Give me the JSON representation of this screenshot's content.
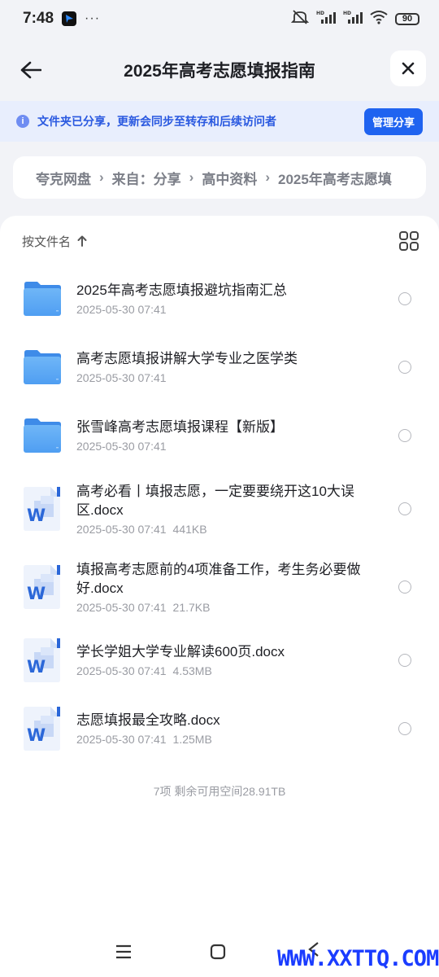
{
  "status_bar": {
    "time": "7:48",
    "more": "···",
    "battery": "90",
    "icons": [
      "app-icon",
      "mute-icon",
      "signal-icon",
      "signal-icon",
      "wifi-icon",
      "battery-icon"
    ]
  },
  "header": {
    "title": "2025年高考志愿填报指南"
  },
  "banner": {
    "text": "文件夹已分享，更新会同步至转存和后续访问者",
    "button": "管理分享"
  },
  "breadcrumb": {
    "items": [
      "夸克网盘",
      "来自：分享",
      "高中资料",
      "2025年高考志愿填"
    ]
  },
  "sort": {
    "label": "按文件名"
  },
  "files": [
    {
      "type": "folder",
      "name": "2025年高考志愿填报避坑指南汇总",
      "date": "2025-05-30 07:41",
      "size": ""
    },
    {
      "type": "folder",
      "name": "高考志愿填报讲解大学专业之医学类",
      "date": "2025-05-30 07:41",
      "size": ""
    },
    {
      "type": "folder",
      "name": "张雪峰高考志愿填报课程【新版】",
      "date": "2025-05-30 07:41",
      "size": ""
    },
    {
      "type": "docx",
      "name": "高考必看丨填报志愿，一定要要绕开这10大误区.docx",
      "date": "2025-05-30 07:41",
      "size": "441KB"
    },
    {
      "type": "docx",
      "name": "填报高考志愿前的4项准备工作，考生务必要做好.docx",
      "date": "2025-05-30 07:41",
      "size": "21.7KB"
    },
    {
      "type": "docx",
      "name": "学长学姐大学专业解读600页.docx",
      "date": "2025-05-30 07:41",
      "size": "4.53MB"
    },
    {
      "type": "docx",
      "name": "志愿填报最全攻略.docx",
      "date": "2025-05-30 07:41",
      "size": "1.25MB"
    }
  ],
  "footer": {
    "info": "7项 剩余可用空间28.91TB"
  },
  "watermark": "WWW.XXTTQ.COM"
}
